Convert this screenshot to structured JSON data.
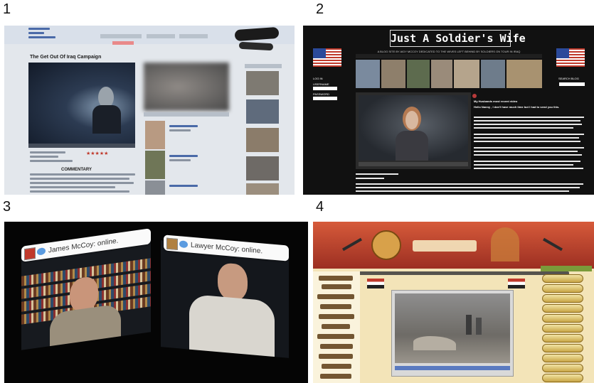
{
  "panels": [
    {
      "number": "1",
      "page_title": "The Get Out Of Iraq Campaign",
      "section_heading": "COMMENTARY"
    },
    {
      "number": "2",
      "site_title": "Just A Soldier's Wife",
      "tagline": "A BLOG SITE BY AIDY MCCOY DEDICATED TO THE WIVES LEFT BEHIND BY SOLDIERS ON TOUR IN IRAQ",
      "left_links": [
        "LOG IN",
        "USERNAME",
        "PASSWORD"
      ],
      "right_label": "SEARCH BLOG",
      "post_title": "My Husbands most recent video",
      "post_subtitle": "Hello Nanny , I don't have much time but I had to send you this."
    },
    {
      "number": "3",
      "chat_left": "James McCoy: online.",
      "chat_right": "Lawyer McCoy: online."
    },
    {
      "number": "4"
    }
  ],
  "colors": {
    "panel2_bg": "#111111",
    "panel4_banner": "#b3392a",
    "panel4_text": "#5b3a14"
  }
}
